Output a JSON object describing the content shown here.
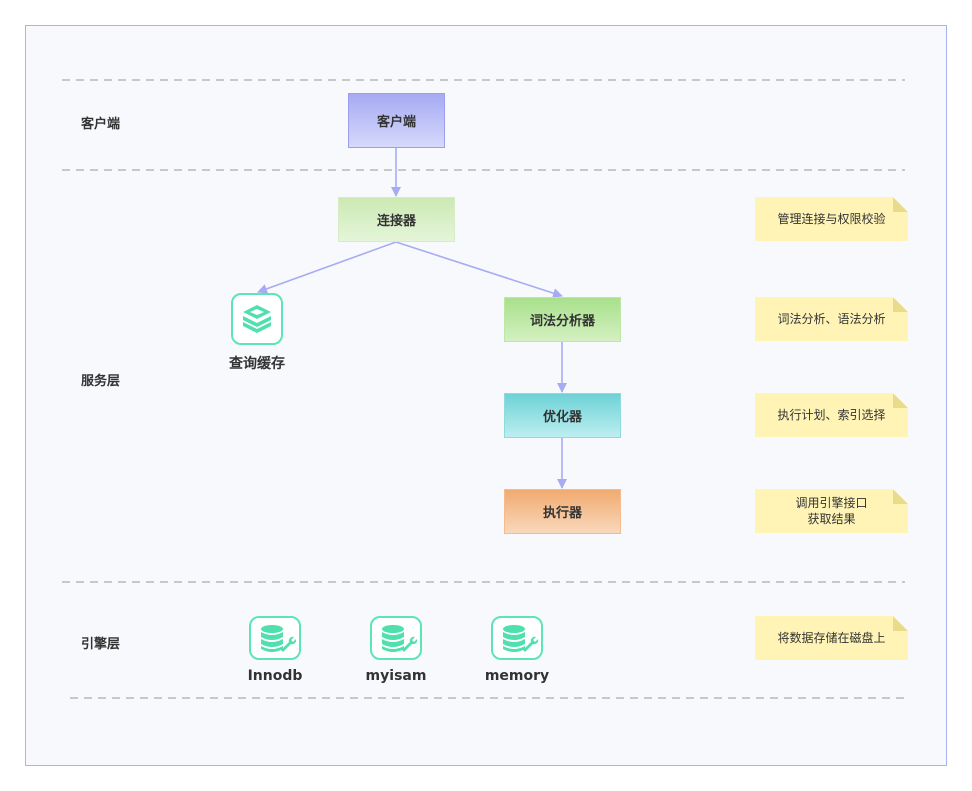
{
  "layers": {
    "client": "客户端",
    "service": "服务层",
    "engine": "引擎层"
  },
  "nodes": {
    "client": "客户端",
    "connector": "连接器",
    "parser": "词法分析器",
    "optimizer": "优化器",
    "executor": "执行器",
    "query_cache": "查询缓存"
  },
  "engines": [
    "Innodb",
    "myisam",
    "memory"
  ],
  "notes": {
    "connector": "管理连接与权限校验",
    "parser": "词法分析、语法分析",
    "optimizer": "执行计划、索引选择",
    "executor_line1": "调用引擎接口",
    "executor_line2": "获取结果",
    "engine": "将数据存储在磁盘上"
  },
  "colors": {
    "arrow": "#a6acf2",
    "note": "#fff4b6",
    "icon": "#5ee4b6"
  }
}
